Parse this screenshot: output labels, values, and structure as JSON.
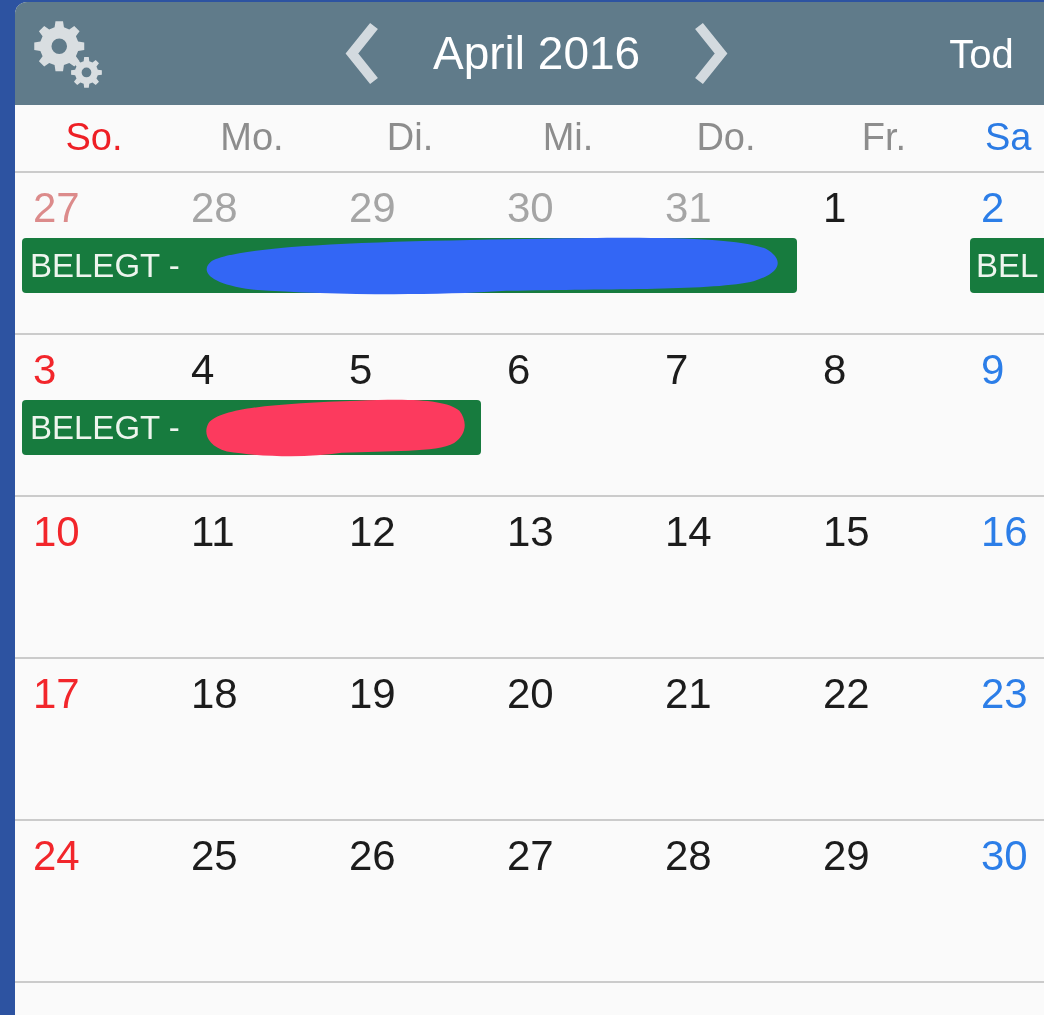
{
  "header": {
    "month_title": "April 2016",
    "today_button": "Tod"
  },
  "weekdays": [
    {
      "label": "So.",
      "kind": "sunday"
    },
    {
      "label": "Mo.",
      "kind": "weekday"
    },
    {
      "label": "Di.",
      "kind": "weekday"
    },
    {
      "label": "Mi.",
      "kind": "weekday"
    },
    {
      "label": "Do.",
      "kind": "weekday"
    },
    {
      "label": "Fr.",
      "kind": "weekday"
    },
    {
      "label": "Sa",
      "kind": "saturday"
    }
  ],
  "weeks": [
    {
      "days": [
        {
          "date": "27",
          "in_month": false,
          "event": {
            "title": "BELEGT -",
            "scribble": {
              "color": "#3366f5"
            }
          }
        },
        {
          "date": "28",
          "in_month": false,
          "event_continues": true
        },
        {
          "date": "29",
          "in_month": false,
          "event_continues": true
        },
        {
          "date": "30",
          "in_month": false,
          "event_continues": true
        },
        {
          "date": "31",
          "in_month": false,
          "event_continues": true
        },
        {
          "date": "1",
          "in_month": true
        },
        {
          "date": "2",
          "in_month": true,
          "event": {
            "title": "BEL"
          }
        }
      ]
    },
    {
      "days": [
        {
          "date": "3",
          "in_month": true,
          "event": {
            "title": "BELEGT -",
            "scribble": {
              "color": "#fc3a5e"
            }
          }
        },
        {
          "date": "4",
          "in_month": true,
          "event_continues": true
        },
        {
          "date": "5",
          "in_month": true,
          "event_continues": true
        },
        {
          "date": "6",
          "in_month": true
        },
        {
          "date": "7",
          "in_month": true
        },
        {
          "date": "8",
          "in_month": true
        },
        {
          "date": "9",
          "in_month": true
        }
      ]
    },
    {
      "days": [
        {
          "date": "10",
          "in_month": true
        },
        {
          "date": "11",
          "in_month": true
        },
        {
          "date": "12",
          "in_month": true
        },
        {
          "date": "13",
          "in_month": true
        },
        {
          "date": "14",
          "in_month": true
        },
        {
          "date": "15",
          "in_month": true
        },
        {
          "date": "16",
          "in_month": true
        }
      ]
    },
    {
      "days": [
        {
          "date": "17",
          "in_month": true
        },
        {
          "date": "18",
          "in_month": true
        },
        {
          "date": "19",
          "in_month": true
        },
        {
          "date": "20",
          "in_month": true
        },
        {
          "date": "21",
          "in_month": true
        },
        {
          "date": "22",
          "in_month": true
        },
        {
          "date": "23",
          "in_month": true
        }
      ]
    },
    {
      "days": [
        {
          "date": "24",
          "in_month": true
        },
        {
          "date": "25",
          "in_month": true
        },
        {
          "date": "26",
          "in_month": true
        },
        {
          "date": "27",
          "in_month": true
        },
        {
          "date": "28",
          "in_month": true
        },
        {
          "date": "29",
          "in_month": true
        },
        {
          "date": "30",
          "in_month": true
        }
      ]
    }
  ]
}
